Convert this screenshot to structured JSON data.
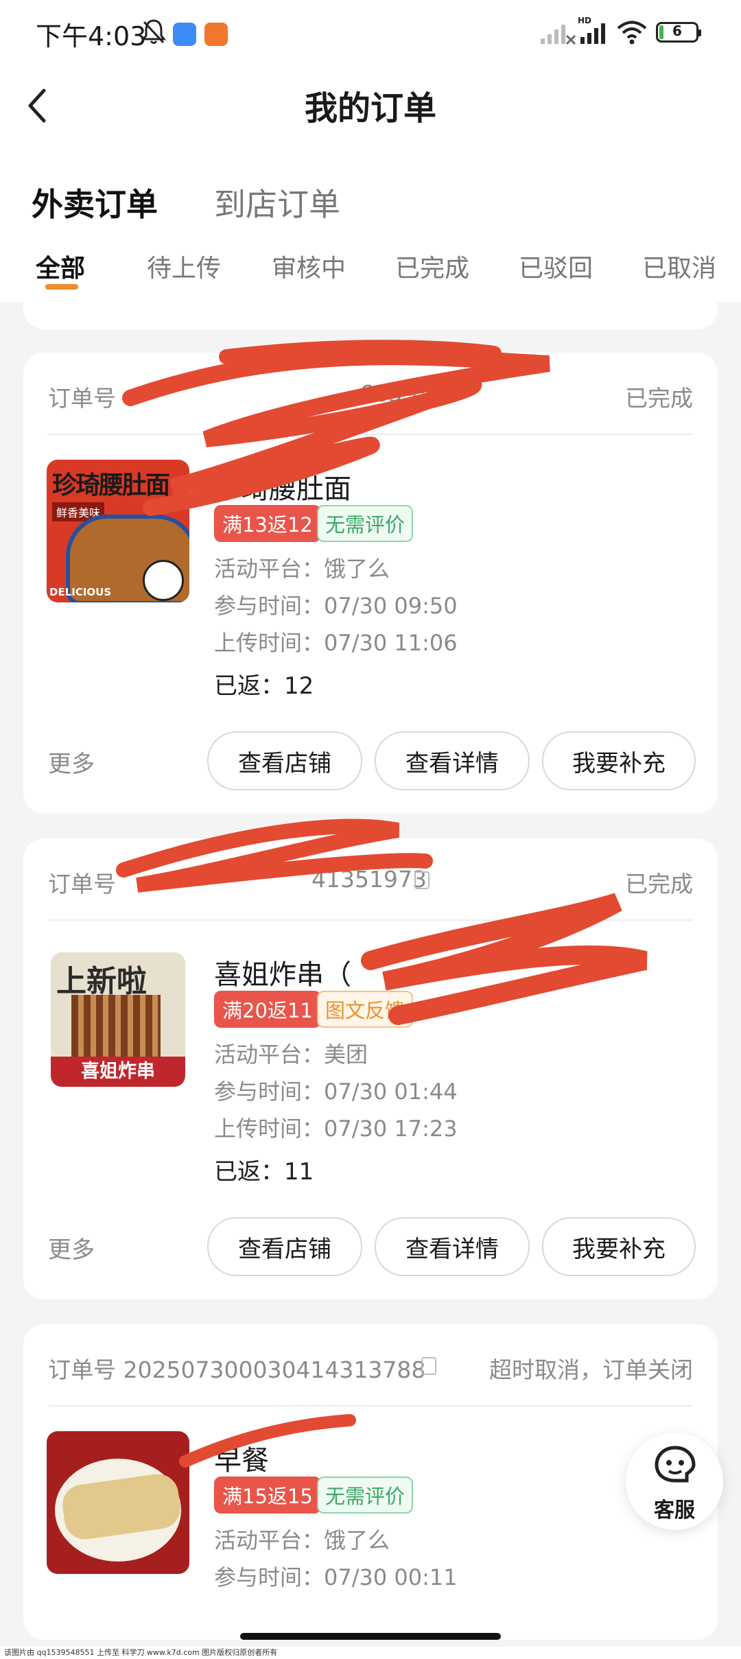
{
  "status_bar": {
    "time": "下午4:03",
    "battery": "6",
    "network": "HD"
  },
  "header": {
    "title": "我的订单"
  },
  "top_tabs": [
    {
      "label": "外卖订单"
    },
    {
      "label": "到店订单"
    }
  ],
  "sub_tabs": [
    {
      "label": "全部"
    },
    {
      "label": "待上传"
    },
    {
      "label": "审核中"
    },
    {
      "label": "已完成"
    },
    {
      "label": "已驳回"
    },
    {
      "label": "已取消"
    }
  ],
  "orders": [
    {
      "order_label": "订单号",
      "order_no_visible": "6859",
      "status": "已完成",
      "thumb_text_top": "珍琦腰肚面",
      "thumb_text_sub": "鲜香美味",
      "thumb_text_bottom": "DELICIOUS",
      "store_name": "珍琦腰肚面",
      "badge_promo": "满13返12",
      "badge_review": "无需评价",
      "platform": "活动平台：饿了么",
      "join_time": "参与时间：07/30 09:50",
      "upload_time": "上传时间：07/30 11:06",
      "returned": "已返：12",
      "more": "更多",
      "buttons": [
        "查看店铺",
        "查看详情",
        "我要补充"
      ]
    },
    {
      "order_label": "订单号",
      "order_no_visible": "41351973",
      "status": "已完成",
      "thumb_text_top": "上新啦",
      "thumb_text_bottom": "喜姐炸串",
      "store_name": "喜姐炸串（",
      "badge_promo": "满20返11",
      "badge_review": "图文反馈",
      "platform": "活动平台：美团",
      "join_time": "参与时间：07/30 01:44",
      "upload_time": "上传时间：07/30 17:23",
      "returned": "已返：11",
      "more": "更多",
      "buttons": [
        "查看店铺",
        "查看详情",
        "我要补充"
      ]
    },
    {
      "order_label": "订单号 2025073000304143137​88",
      "status": "超时取消，订单关闭",
      "store_name": "早餐",
      "badge_promo": "满15返15",
      "badge_review": "无需评价",
      "platform": "活动平台：饿了么",
      "join_time": "参与时间：07/30 00:11"
    }
  ],
  "service": {
    "label": "客服"
  },
  "footer": {
    "text": "该图片由 qq1539548551 上传至 科学刀 www.k7d.com 图片版权归原创者所有"
  },
  "colors": {
    "accent": "#f08a2c",
    "promo_red": "#e9554a",
    "review_green": "#3ca865",
    "review_orange": "#e8922e",
    "scribble": "#e34a32"
  }
}
